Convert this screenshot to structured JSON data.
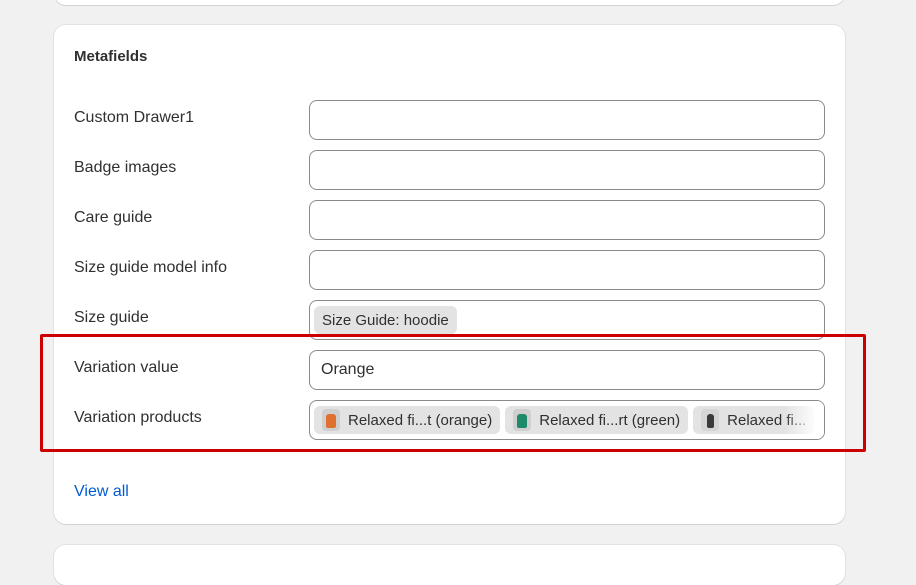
{
  "metafields": {
    "title": "Metafields",
    "rows": [
      {
        "label": "Custom Drawer1",
        "value": ""
      },
      {
        "label": "Badge images",
        "value": ""
      },
      {
        "label": "Care guide",
        "value": ""
      },
      {
        "label": "Size guide model info",
        "value": ""
      },
      {
        "label": "Size guide",
        "chip": "Size Guide: hoodie"
      },
      {
        "label": "Variation value",
        "value": "Orange"
      },
      {
        "label": "Variation products",
        "chips": [
          {
            "label": "Relaxed fi...t (orange)",
            "icon": "product-thumbnail-orange"
          },
          {
            "label": "Relaxed fi...rt (green)",
            "icon": "product-thumbnail-green"
          },
          {
            "label": "Relaxed fi...",
            "icon": "product-thumbnail-black"
          }
        ]
      }
    ],
    "view_all": "View all"
  },
  "colors": {
    "link": "#005bd3",
    "highlight": "#cc0000",
    "chip_bg": "#e3e3e3"
  }
}
